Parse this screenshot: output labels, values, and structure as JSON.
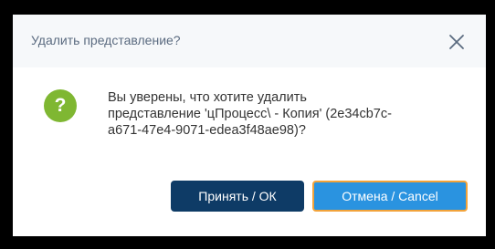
{
  "dialog": {
    "title": "Удалить представление?",
    "close_icon": "close-icon",
    "question_icon": "question-icon",
    "question_symbol": "?",
    "message_lines": [
      "Вы уверены, что хотите удалить",
      "представление 'цПроцесс\\ - Копия' (2e34cb7c-",
      "a671-47e4-9071-edea3f48ae98)?"
    ],
    "ok_label": "Принять / ОК",
    "cancel_label": "Отмена / Cancel",
    "colors": {
      "header_bg": "#f6f8fa",
      "question_icon": "#7fb732",
      "ok_button": "#0e3b66",
      "cancel_button": "#2a93e0",
      "cancel_border": "#f2a33a"
    }
  }
}
